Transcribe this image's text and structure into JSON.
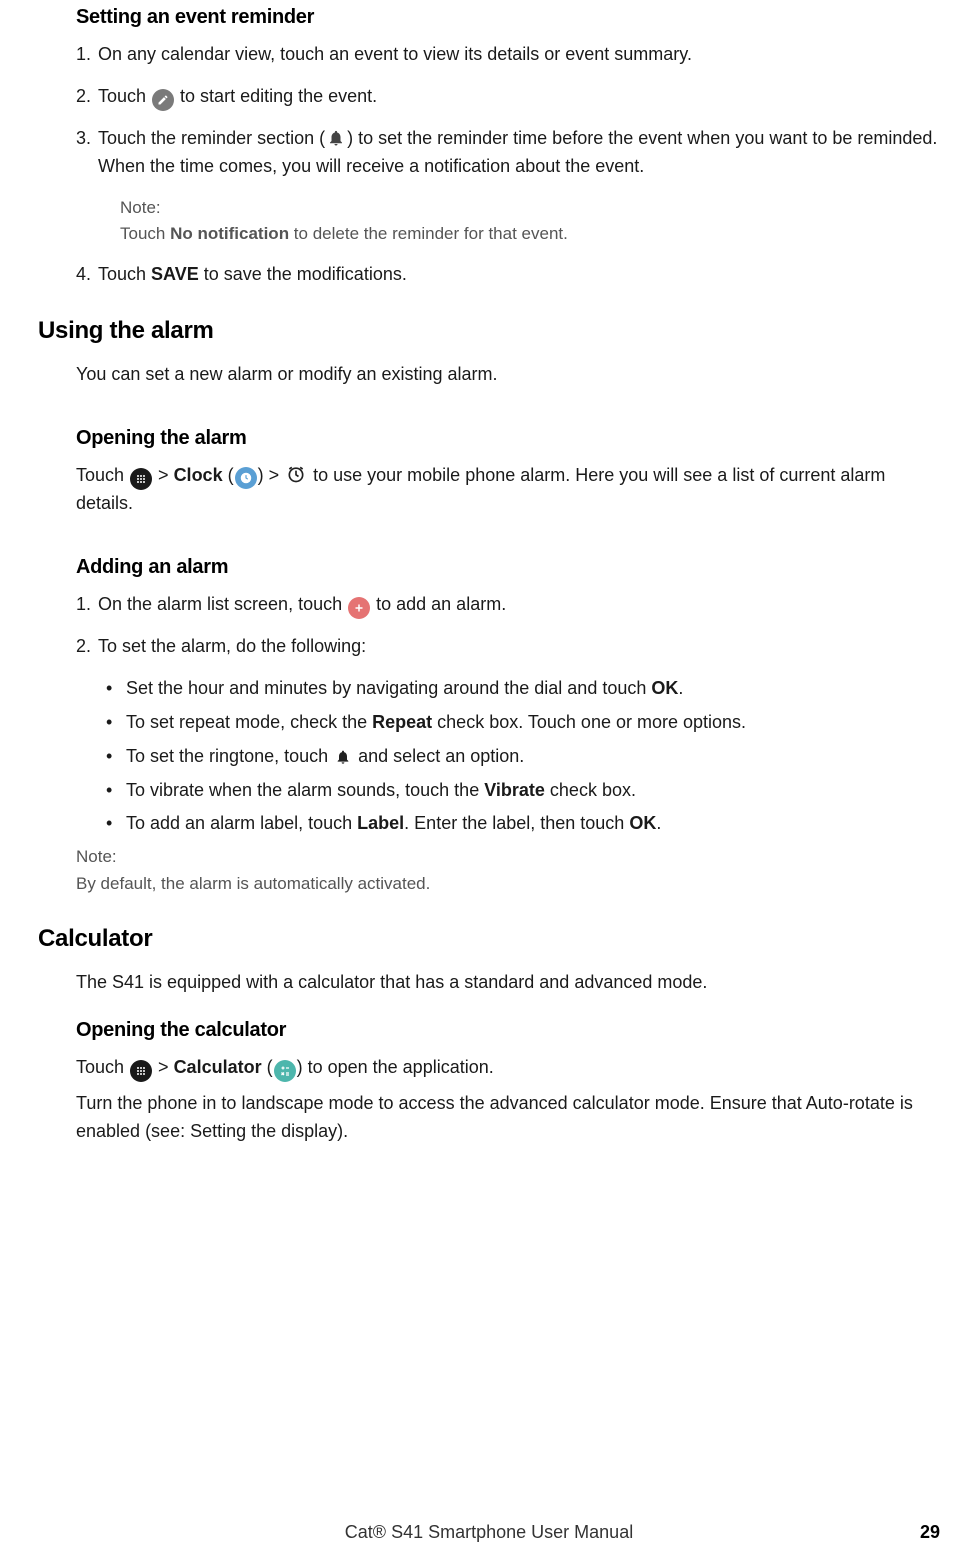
{
  "s1": {
    "h": "Setting an event reminder",
    "i1": "On any calendar view, touch an event to view its details or event summary.",
    "i2a": "Touch ",
    "i2b": " to start editing the event.",
    "i3a": "Touch the reminder section (",
    "i3b": ") to set the reminder time before the event when you want to be reminded. When the time comes, you will receive a notification about the event.",
    "note_label": "Note:",
    "note_a": "Touch ",
    "note_b": "No notification",
    "note_c": " to delete the reminder for that event.",
    "i4a": "Touch ",
    "i4b": "SAVE",
    "i4c": " to save the modifications."
  },
  "s2": {
    "h": "Using the alarm",
    "intro": "You can set a new alarm or modify an existing alarm.",
    "sub1_h": "Opening the alarm",
    "sub1_a": "Touch ",
    "sub1_b": " > ",
    "sub1_c": "Clock",
    "sub1_d": " (",
    "sub1_e": ") > ",
    "sub1_f": " to use your mobile phone alarm. Here you will see a list of current alarm details.",
    "sub2_h": "Adding an alarm",
    "sub2_i1a": "On the alarm list screen, touch ",
    "sub2_i1b": " to add an alarm.",
    "sub2_i2": "To set the alarm, do the following:",
    "b1a": "Set the hour and minutes by navigating around the dial and touch ",
    "b1b": "OK",
    "b1c": ".",
    "b2a": "To set repeat mode, check the ",
    "b2b": "Repeat",
    "b2c": " check box. Touch one or more options.",
    "b3a": "To set the ringtone, touch  ",
    "b3b": "  and select an option.",
    "b4a": "To vibrate when the alarm sounds, touch the ",
    "b4b": "Vibrate",
    "b4c": " check box.",
    "b5a": "To add an alarm label, touch ",
    "b5b": "Label",
    "b5c": ". Enter the label, then touch ",
    "b5d": "OK",
    "b5e": ".",
    "note2_label": "Note:",
    "note2_body": "By default, the alarm is automatically activated."
  },
  "s3": {
    "h": "Calculator",
    "intro": "The S41 is equipped with a calculator that has a standard and advanced mode.",
    "sub_h": "Opening the calculator",
    "p1a": "Touch ",
    "p1b": " > ",
    "p1c": "Calculator",
    "p1d": " (",
    "p1e": ") to open the application.",
    "p2": "Turn the phone in to landscape mode to access the advanced calculator mode. Ensure that Auto-rotate is enabled (see: Setting the display)."
  },
  "footer": {
    "title": "Cat® S41 Smartphone User Manual",
    "page": "29"
  }
}
